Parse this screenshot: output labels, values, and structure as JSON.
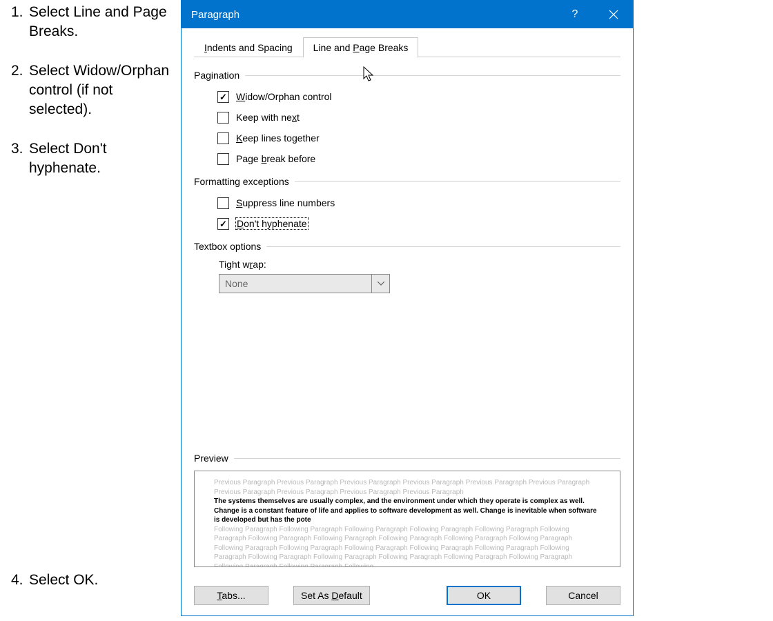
{
  "instructions": {
    "items": [
      "Select Line and Page Breaks.",
      "Select Widow/Orphan control (if not selected).",
      "Select Don't hyphenate.",
      "Select OK."
    ]
  },
  "dialog": {
    "title": "Paragraph",
    "tabs": {
      "indents": "Indents and Spacing",
      "breaks": "Line and Page Breaks"
    },
    "pagination": {
      "legend": "Pagination",
      "widow": "Widow/Orphan control",
      "widow_checked": true,
      "keepnext": "Keep with next",
      "keeplines": "Keep lines together",
      "pagebreak": "Page break before"
    },
    "fmt": {
      "legend": "Formatting exceptions",
      "suppress": "Suppress line numbers",
      "donthyph": "Don't hyphenate",
      "donthyph_checked": true
    },
    "textbox": {
      "legend": "Textbox options",
      "tightwrap_label": "Tight wrap:",
      "tightwrap_value": "None"
    },
    "preview": {
      "legend": "Preview",
      "prev": "Previous Paragraph Previous Paragraph Previous Paragraph Previous Paragraph Previous Paragraph Previous Paragraph Previous Paragraph Previous Paragraph Previous Paragraph Previous Paragraph",
      "sample": "The systems themselves are usually complex, and the environment under which they operate is complex as well. Change is a constant feature of life and applies to software development as well. Change is inevitable when software is developed but has the pote",
      "foll": "Following Paragraph Following Paragraph Following Paragraph Following Paragraph Following Paragraph Following Paragraph Following Paragraph Following Paragraph Following Paragraph Following Paragraph Following Paragraph Following Paragraph Following Paragraph Following Paragraph Following Paragraph Following Paragraph Following Paragraph Following Paragraph Following Paragraph Following Paragraph Following Paragraph Following Paragraph Following Paragraph Following Paragraph Following"
    },
    "buttons": {
      "tabs": "Tabs...",
      "setdefault": "Set As Default",
      "ok": "OK",
      "cancel": "Cancel"
    }
  }
}
